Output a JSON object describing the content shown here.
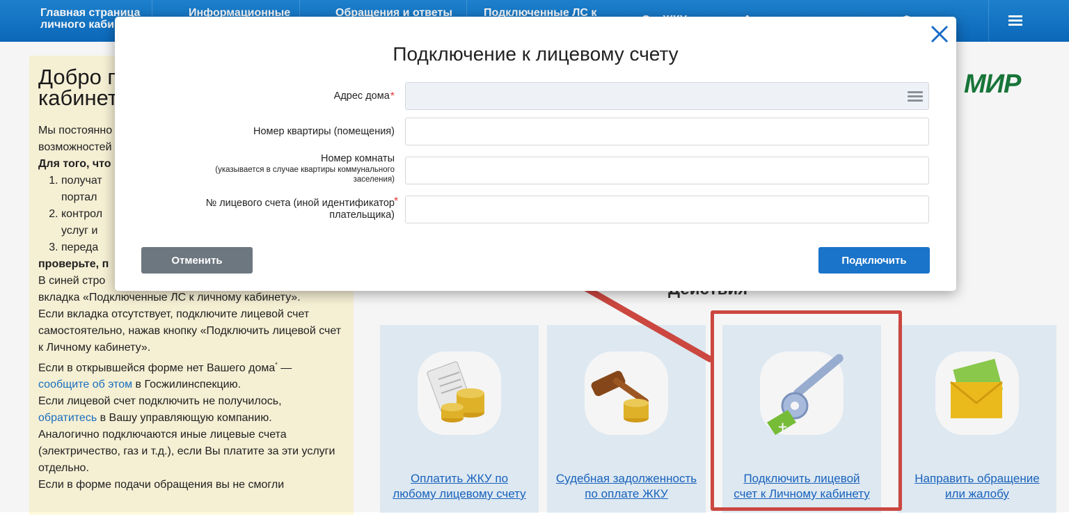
{
  "nav": {
    "items": [
      {
        "label": "Главная страница\nличного каби"
      },
      {
        "label": "Информационные"
      },
      {
        "label": "Обращения и ответы"
      },
      {
        "label": "Подключенные ЛС к"
      },
      {
        "label": "О... ЖКУ"
      },
      {
        "label": "А"
      },
      {
        "label": "Ф"
      }
    ],
    "menu_icon": "hamburger-icon"
  },
  "page": {
    "welcome_title": "Добро по\nкабинет",
    "intro_line1": "Мы постоянно",
    "intro_line2": "возможностей",
    "bold_line": "Для того, что",
    "list": [
      "получат",
      "портал",
      "контрол",
      "услуг и",
      "переда"
    ],
    "check_line": "проверьте, п",
    "p1": "В синей стро",
    "p2": "вкладка «Подключенные ЛС к личному кабинету».",
    "p3": "Если вкладка отсутствует, подключите лицевой счет самостоятельно, нажав кнопку «Подключить лицевой счет к Личному кабинету».",
    "p4_a": "Если в открывшейся форме нет Вашего дома",
    "p4_b": " —",
    "p4_link": "сообщите об этом",
    "p4_c": " в Госжилинспекцию.",
    "p5": "Если лицевой счет подключить не получилось,",
    "p5_link": "обратитесь",
    "p5_c": " в Вашу управляющую компанию.",
    "p6": "Аналогично подключаются иные лицевые счета (электричество, газ и т.д.), если Вы платите за эти услуги отдельно.",
    "p7": "Если в форме подачи обращения вы не смогли",
    "mir_logo": "МИР",
    "actions_title": "Действия",
    "cards": [
      {
        "label": "Оплатить ЖКУ по\nлюбому лицевому счету",
        "icon": "payment-coins-icon"
      },
      {
        "label": "Судебная задолженность\nпо оплате ЖКУ",
        "icon": "gavel-icon"
      },
      {
        "label": "Подключить лицевой\nсчет к Личному кабинету",
        "icon": "key-icon"
      },
      {
        "label": "Направить обращение\nили жалобу",
        "icon": "envelope-icon"
      }
    ]
  },
  "dialog": {
    "title": "Подключение к лицевому счету",
    "fields": {
      "address_label": "Адрес дома",
      "flat_label": "Номер квартиры (помещения)",
      "room_label": "Номер комнаты",
      "room_hint": "(указывается в случае квартиры коммунального\nзаселения)",
      "account_label": "№ лицевого счета (иной идентификатор\nплательщика)",
      "required_mark": "*"
    },
    "cancel_label": "Отменить",
    "connect_label": "Подключить"
  },
  "colors": {
    "nav": "#1479cc",
    "accent": "#1a74c9",
    "highlight": "#d44a43",
    "info_bg": "#fff9dd",
    "card_bg": "#e7f2fb"
  }
}
